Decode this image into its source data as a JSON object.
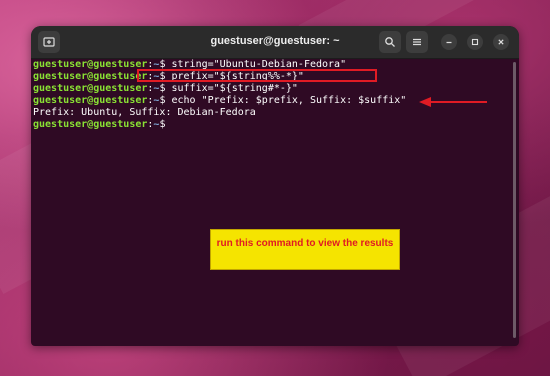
{
  "window": {
    "title": "guestuser@guestuser: ~",
    "new_tab_icon": "new-tab-icon",
    "search_icon": "search-icon",
    "menu_icon": "hamburger-menu-icon",
    "minimize_icon": "minimize-icon",
    "maximize_icon": "maximize-icon",
    "close_icon": "close-icon"
  },
  "terminal": {
    "prompt_user": "guestuser@guestuser",
    "prompt_colon": ":",
    "prompt_path": "~",
    "prompt_symbol": "$ ",
    "commands": [
      "string=\"Ubuntu-Debian-Fedora\"",
      "prefix=\"${string%%-*}\"",
      "suffix=\"${string#*-}\"",
      "echo \"Prefix: $prefix, Suffix: $suffix\""
    ],
    "output": "Prefix: Ubuntu, Suffix: Debian-Fedora"
  },
  "annotation": {
    "callout_text": "run this command to view the results",
    "highlight_color": "#e01b24",
    "callout_bg": "#f5e400"
  },
  "colors": {
    "terminal_bg": "#2f0a24",
    "prompt_user": "#8ae234",
    "prompt_path": "#7fa8d6",
    "titlebar_bg": "#2b2b2b"
  }
}
